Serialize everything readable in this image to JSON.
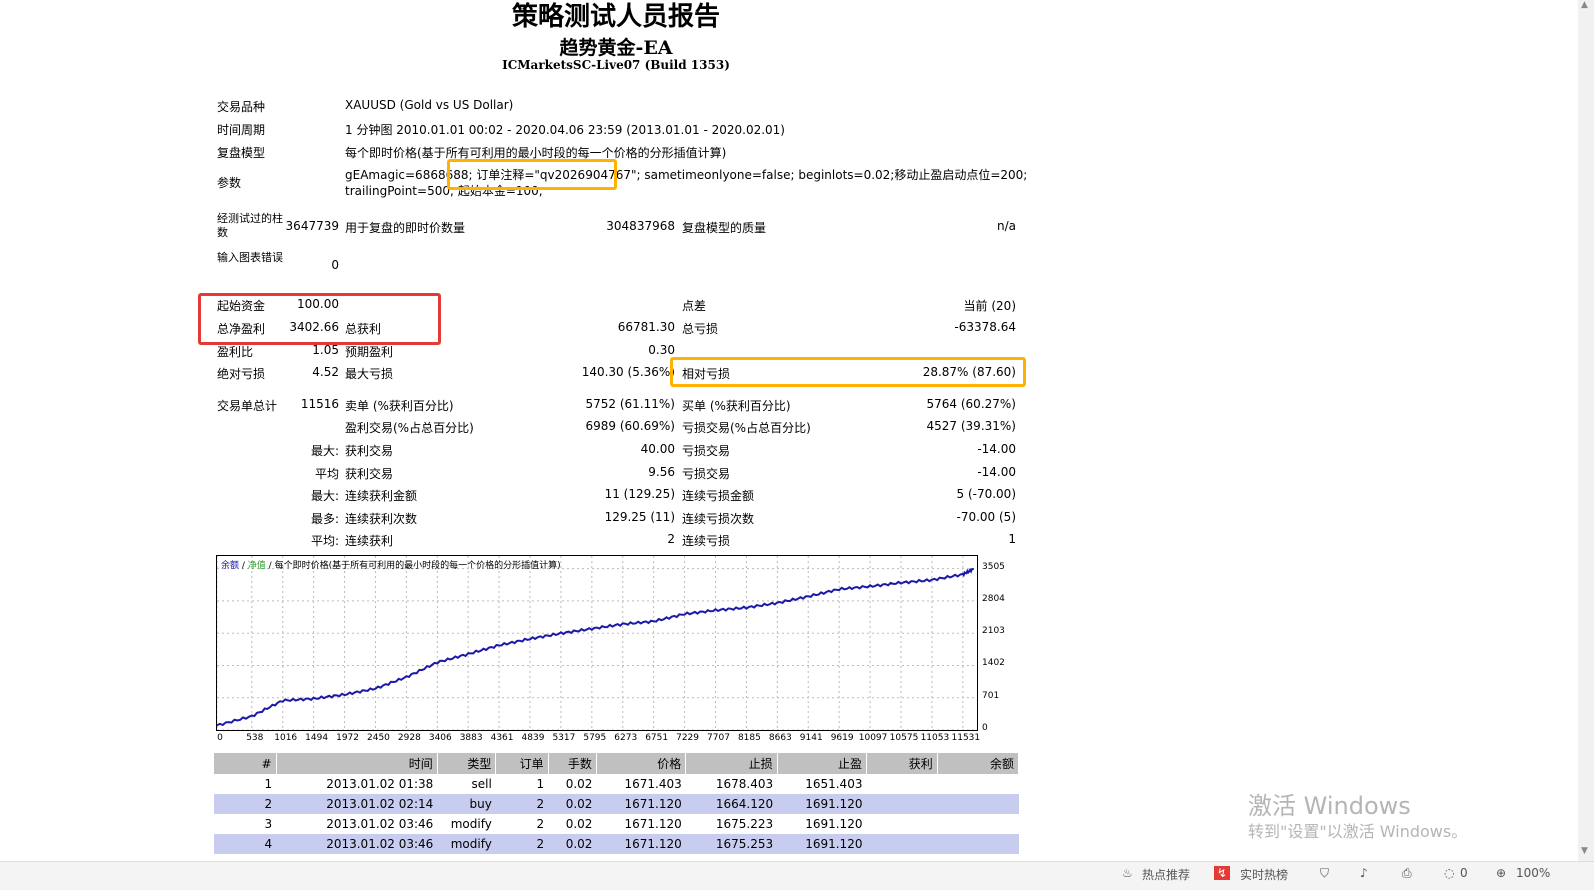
{
  "header": {
    "title": "策略测试人员报告",
    "ea_name": "趋势黄金-EA",
    "server": "ICMarketsSC-Live07 (Build 1353)"
  },
  "info": {
    "symbol_label": "交易品种",
    "symbol_value": "XAUUSD (Gold vs US Dollar)",
    "period_label": "时间周期",
    "period_value": "1 分钟图 2010.01.01 00:02 - 2020.04.06 23:59 (2013.01.01 - 2020.02.01)",
    "model_label": "复盘模型",
    "model_value": "每个即时价格(基于所有可利用的最小时段的每一个价格的分形插值计算)",
    "params_label": "参数",
    "params_line1": "gEAmagic=6868688; 订单注释=\"qv2026904767\"; sametimeonlyone=false; beginlots=0.02;移动止盈启动点位=200;",
    "params_line2": "trailingPoint=500; 起始本金=100;"
  },
  "stats": {
    "bars_label": "经测试过的柱数",
    "bars_value": "3647739",
    "ticks_label": "用于复盘的即时价数量",
    "ticks_value": "304837968",
    "quality_label": "复盘模型的质量",
    "quality_value": "n/a",
    "errors_label": "输入图表错误",
    "errors_value": "0",
    "deposit_label": "起始资金",
    "deposit_value": "100.00",
    "spread_label": "点差",
    "spread_value": "当前 (20)",
    "netprofit_label": "总净盈利",
    "netprofit_value": "3402.66",
    "grossprofit_label": "总获利",
    "grossprofit_value": "66781.30",
    "grossloss_label": "总亏损",
    "grossloss_value": "-63378.64",
    "pf_label": "盈利比",
    "pf_value": "1.05",
    "expected_label": "预期盈利",
    "expected_value": "0.30",
    "absdd_label": "绝对亏损",
    "absdd_value": "4.52",
    "maxdd_label": "最大亏损",
    "maxdd_value": "140.30 (5.36%)",
    "reldd_label": "相对亏损",
    "reldd_value": "28.87% (87.60)",
    "total_label": "交易单总计",
    "total_value": "11516",
    "short_label": "卖单 (%获利百分比)",
    "short_value": "5752 (61.11%)",
    "long_label": "买单 (%获利百分比)",
    "long_value": "5764 (60.27%)",
    "profitt_label": "盈利交易(%占总百分比)",
    "profitt_value": "6989 (60.69%)",
    "losst_label": "亏损交易(%占总百分比)",
    "losst_value": "4527 (39.31%)",
    "max_label": "最大:",
    "avg_label": "平均",
    "largest_profit_label": "获利交易",
    "largest_profit_value": "40.00",
    "largest_loss_label": "亏损交易",
    "largest_loss_value": "-14.00",
    "avg_profit_label": "获利交易",
    "avg_profit_value": "9.56",
    "avg_loss_label": "亏损交易",
    "avg_loss_value": "-14.00",
    "max2_label": "最大:",
    "maxconswin_label": "连续获利金额",
    "maxconswin_value": "11 (129.25)",
    "maxconsloss_label": "连续亏损金额",
    "maxconsloss_value": "5 (-70.00)",
    "max3_label": "最多:",
    "maxconsprofit_label": "连续获利次数",
    "maxconsprofit_value": "129.25 (11)",
    "maxconsloss2_label": "连续亏损次数",
    "maxconsloss2_value": "-70.00 (5)",
    "avg2_label": "平均:",
    "avgconswin_label": "连续获利",
    "avgconswin_value": "2",
    "avgconsloss_label": "连续亏损",
    "avgconsloss_value": "1"
  },
  "chart_data": {
    "type": "line",
    "legend": {
      "balance": "余额",
      "sep1": " / ",
      "equity": "净值",
      "sep2": " / ",
      "model": "每个即时价格(基于所有可利用的最小时段的每一个价格的分形插值计算)"
    },
    "x_ticks": [
      "0",
      "538",
      "1016",
      "1494",
      "1972",
      "2450",
      "2928",
      "3406",
      "3883",
      "4361",
      "4839",
      "5317",
      "5795",
      "6273",
      "6751",
      "7229",
      "7707",
      "8185",
      "8663",
      "9141",
      "9619",
      "10097",
      "10575",
      "11053",
      "11531"
    ],
    "y_ticks": [
      "3505",
      "2804",
      "2103",
      "1402",
      "701",
      "0"
    ],
    "xlim": [
      0,
      11750
    ],
    "ylim": [
      0,
      3780
    ],
    "series": [
      {
        "name": "余额",
        "color": "#1a1aa6",
        "x": [
          0,
          538,
          1016,
          1494,
          1972,
          2450,
          2928,
          3406,
          3883,
          4361,
          4839,
          5317,
          5795,
          6273,
          6751,
          7229,
          7707,
          8185,
          8663,
          9141,
          9619,
          10097,
          10575,
          11053,
          11531,
          11700
        ],
        "y": [
          100,
          300,
          640,
          680,
          770,
          900,
          1150,
          1470,
          1650,
          1840,
          1980,
          2100,
          2200,
          2300,
          2360,
          2520,
          2600,
          2660,
          2760,
          2900,
          3060,
          3120,
          3200,
          3260,
          3380,
          3500
        ]
      }
    ]
  },
  "trades": {
    "headers": [
      "#",
      "时间",
      "类型",
      "订单",
      "手数",
      "价格",
      "止损",
      "止盈",
      "获利",
      "余额"
    ],
    "rows": [
      [
        "1",
        "2013.01.02 01:38",
        "sell",
        "1",
        "0.02",
        "1671.403",
        "1678.403",
        "1651.403",
        "",
        ""
      ],
      [
        "2",
        "2013.01.02 02:14",
        "buy",
        "2",
        "0.02",
        "1671.120",
        "1664.120",
        "1691.120",
        "",
        ""
      ],
      [
        "3",
        "2013.01.02 03:46",
        "modify",
        "2",
        "0.02",
        "1671.120",
        "1675.223",
        "1691.120",
        "",
        ""
      ],
      [
        "4",
        "2013.01.02 03:46",
        "modify",
        "2",
        "0.02",
        "1671.120",
        "1675.253",
        "1691.120",
        "",
        ""
      ]
    ]
  },
  "watermark": {
    "line1": "激活 Windows",
    "line2": "转到\"设置\"以激活 Windows。"
  },
  "statusbar": {
    "hot": "热点推荐",
    "live": "实时热榜",
    "comments": "0",
    "zoom": "100%"
  },
  "colors": {
    "red_box": "#e53935",
    "orange_box": "#ffb300",
    "row_alt": "#c8cdf0",
    "header_bg": "#c0c0c0",
    "line": "#1a1aa6"
  }
}
